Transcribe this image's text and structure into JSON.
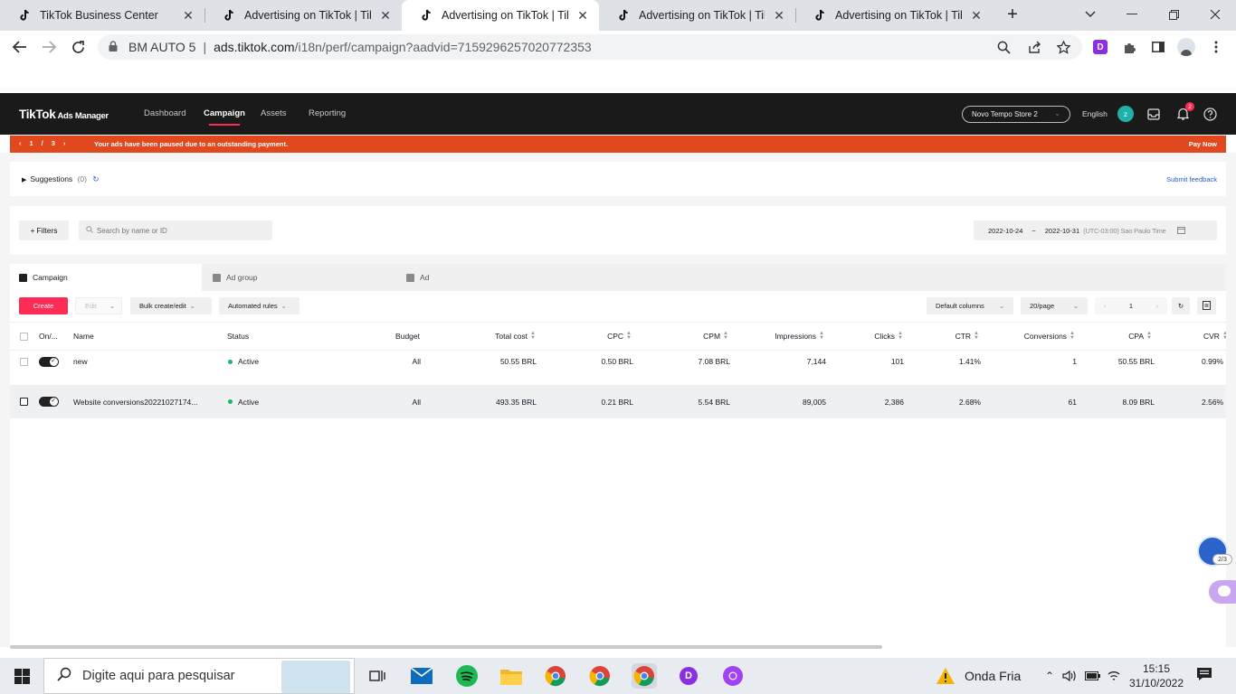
{
  "browser": {
    "tabs": [
      {
        "title": "TikTok Business Center",
        "active": false
      },
      {
        "title": "Advertising on TikTok | TikTok",
        "active": false
      },
      {
        "title": "Advertising on TikTok | TikTok",
        "active": true
      },
      {
        "title": "Advertising on TikTok | TikTok",
        "active": false
      },
      {
        "title": "Advertising on TikTok | TikTok",
        "active": false
      }
    ],
    "profile_label": "BM AUTO 5",
    "url_host": "ads.tiktok.com",
    "url_path": "/i18n/perf/campaign?aadvid=7159296257020772353"
  },
  "header": {
    "logo": "TikTok",
    "logo_sub": "Ads Manager",
    "nav": [
      "Dashboard",
      "Campaign",
      "Assets",
      "Reporting"
    ],
    "active_nav": "Campaign",
    "account": "Novo Tempo Store 2",
    "language": "English",
    "avatar_letter": "z",
    "notification_count": "2"
  },
  "alert": {
    "page_current": "1",
    "page_sep": "/",
    "page_total": "3",
    "message": "Your ads have been paused due to an outstanding payment.",
    "action": "Pay Now",
    "color": "#e1481d"
  },
  "suggestions": {
    "label": "Suggestions",
    "count": "(0)",
    "feedback": "Submit feedback"
  },
  "filters": {
    "filters_label": "Filters",
    "search_placeholder": "Search by name or ID",
    "date_start": "2022-10-24",
    "date_sep": "~",
    "date_end": "2022-10-31",
    "timezone": "(UTC-03:00) Sao Paulo Time"
  },
  "level_tabs": [
    "Campaign",
    "Ad group",
    "Ad"
  ],
  "actions": {
    "create": "Create",
    "edit": "Edit",
    "bulk": "Bulk create/edit",
    "automated": "Automated rules",
    "columns": "Default columns",
    "per_page": "20/page",
    "page": "1"
  },
  "table": {
    "columns": [
      "On/...",
      "Name",
      "Status",
      "Budget",
      "Total cost",
      "CPC",
      "CPM",
      "Impressions",
      "Clicks",
      "CTR",
      "Conversions",
      "CPA",
      "CVR"
    ],
    "rows": [
      {
        "on": true,
        "name": "new",
        "status": "Active",
        "budget": "All",
        "total_cost": "50.55 BRL",
        "cpc": "0.50 BRL",
        "cpm": "7.08 BRL",
        "impressions": "7,144",
        "clicks": "101",
        "ctr": "1.41%",
        "conversions": "1",
        "cpa": "50.55 BRL",
        "cvr": "0.99%"
      },
      {
        "on": true,
        "name": "Website conversions20221027174...",
        "status": "Active",
        "budget": "All",
        "total_cost": "493.35 BRL",
        "cpc": "0.21 BRL",
        "cpm": "5.54 BRL",
        "impressions": "89,005",
        "clicks": "2,386",
        "ctr": "2.68%",
        "conversions": "61",
        "cpa": "8.09 BRL",
        "cvr": "2.56%"
      }
    ]
  },
  "floating": {
    "badge": "2/3"
  },
  "taskbar": {
    "search_placeholder": "Digite aqui para pesquisar",
    "weather": "Onda Fria",
    "time": "15:15",
    "date": "31/10/2022"
  },
  "colors": {
    "accent": "#fe2c55",
    "active_status": "#1bb66c",
    "header_bg": "#1a1a1a"
  }
}
